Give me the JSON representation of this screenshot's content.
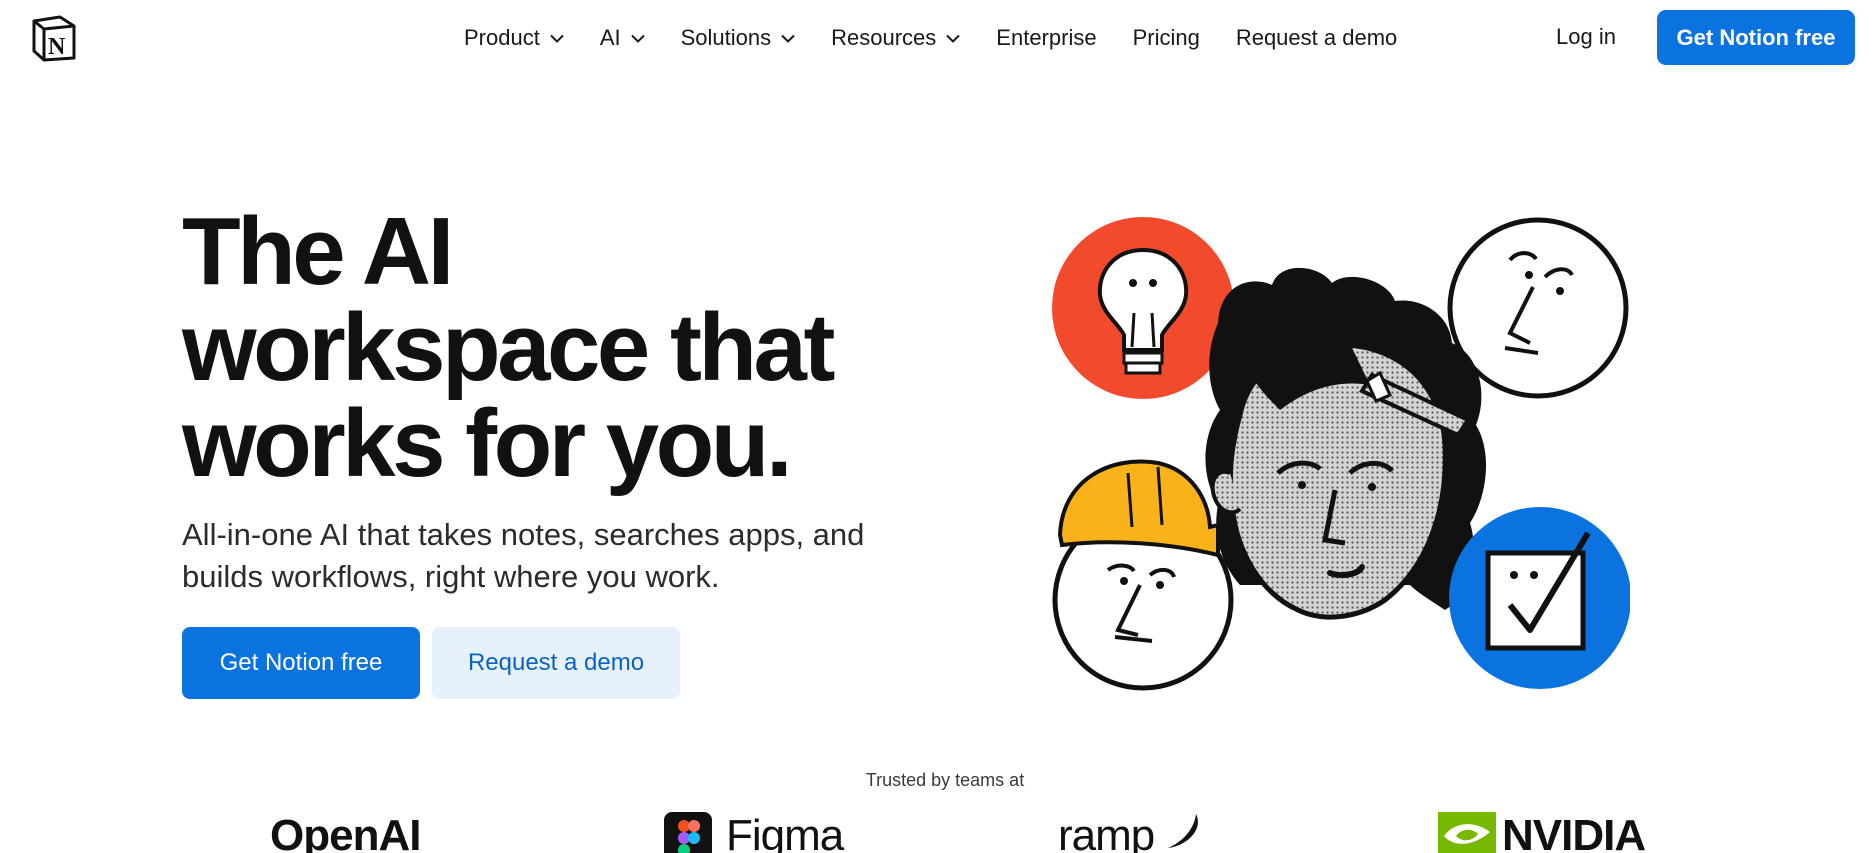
{
  "header": {
    "nav": [
      {
        "label": "Product",
        "dropdown": true
      },
      {
        "label": "AI",
        "dropdown": true
      },
      {
        "label": "Solutions",
        "dropdown": true
      },
      {
        "label": "Resources",
        "dropdown": true
      },
      {
        "label": "Enterprise",
        "dropdown": false
      },
      {
        "label": "Pricing",
        "dropdown": false
      },
      {
        "label": "Request a demo",
        "dropdown": false
      }
    ],
    "login_label": "Log in",
    "cta_label": "Get Notion free"
  },
  "hero": {
    "headline_line1": "The AI",
    "headline_line2": "workspace that",
    "headline_line3": "works for you.",
    "subhead_line1": "All-in-one AI that takes notes, searches apps, and",
    "subhead_line2": "builds workflows, right where you work.",
    "primary_label": "Get Notion free",
    "secondary_label": "Request a demo"
  },
  "trusted": {
    "label": "Trusted by teams at",
    "logos": [
      {
        "name": "OpenAI",
        "icon": "openai-logo"
      },
      {
        "name": "Figma",
        "icon": "figma-logo"
      },
      {
        "name": "ramp",
        "icon": "ramp-logo"
      },
      {
        "name": "NVIDIA",
        "icon": "nvidia-logo"
      }
    ]
  },
  "colors": {
    "accent": "#0a73e0",
    "accent_light": "#e6f1fd",
    "bulb_circle": "#f24a2c",
    "task_circle": "#0a73e0",
    "helmet": "#f9b21a"
  }
}
